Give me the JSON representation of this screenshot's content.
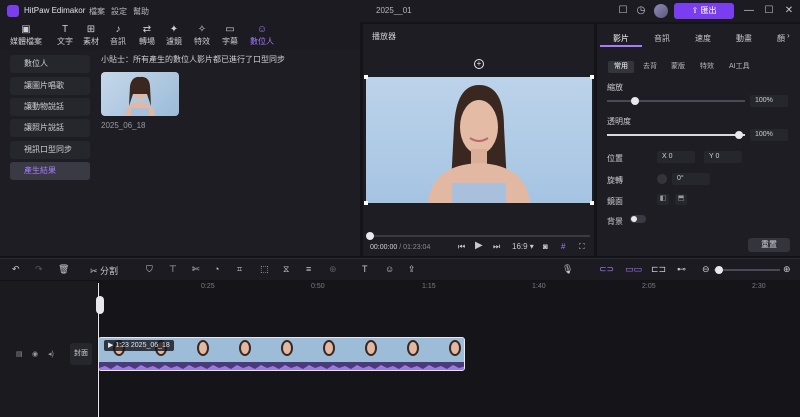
{
  "titlebar": {
    "app_title": "HitPaw Edimakor",
    "menu": [
      "檔案",
      "設定",
      "幫助"
    ],
    "project_title": "2025__01",
    "export_label": "匯出"
  },
  "toolbar": {
    "tools": [
      {
        "label": "媒體檔案",
        "icon": "media-icon"
      },
      {
        "label": "文字",
        "icon": "text-icon"
      },
      {
        "label": "素材",
        "icon": "material-icon"
      },
      {
        "label": "音訊",
        "icon": "audio-icon"
      },
      {
        "label": "轉場",
        "icon": "transition-icon"
      },
      {
        "label": "濾鏡",
        "icon": "filter-icon"
      },
      {
        "label": "特效",
        "icon": "effects-icon"
      },
      {
        "label": "字幕",
        "icon": "subtitle-icon"
      },
      {
        "label": "數位人",
        "icon": "digital-human-icon"
      }
    ]
  },
  "sidebar": {
    "items": [
      "數位人",
      "讓圖片唱歌",
      "讓動物說話",
      "讓照片說話",
      "視訊口型同步",
      "產生結果"
    ]
  },
  "content": {
    "tip": "小貼士：所有產生的數位人影片都已進行了口型同步",
    "thumb_date": "2025_06_18"
  },
  "player": {
    "title": "播放器",
    "current_time": "00:00:00",
    "total_time": "/ 01:23:04",
    "aspect": "16:9"
  },
  "right_panel": {
    "tabs": [
      "影片",
      "音訊",
      "速度",
      "動畫",
      "顏"
    ],
    "subtabs": [
      "常用",
      "去背",
      "蒙版",
      "特效",
      "AI工具"
    ],
    "scale_label": "縮放",
    "scale_value": "100%",
    "opacity_label": "透明度",
    "opacity_value": "100%",
    "position_label": "位置",
    "pos_x": "X 0",
    "pos_y": "Y 0",
    "rotate_label": "旋轉",
    "rotate_value": "0°",
    "mirror_label": "鏡面",
    "background_label": "背景",
    "reset_label": "重置"
  },
  "edit_toolbar": {
    "split_label": "分割"
  },
  "timeline": {
    "ticks": [
      "0:25",
      "0:50",
      "1:15",
      "1:40",
      "2:05",
      "2:30"
    ],
    "clip_label": "1:23 2025_06_18",
    "cover_label": "封面"
  }
}
